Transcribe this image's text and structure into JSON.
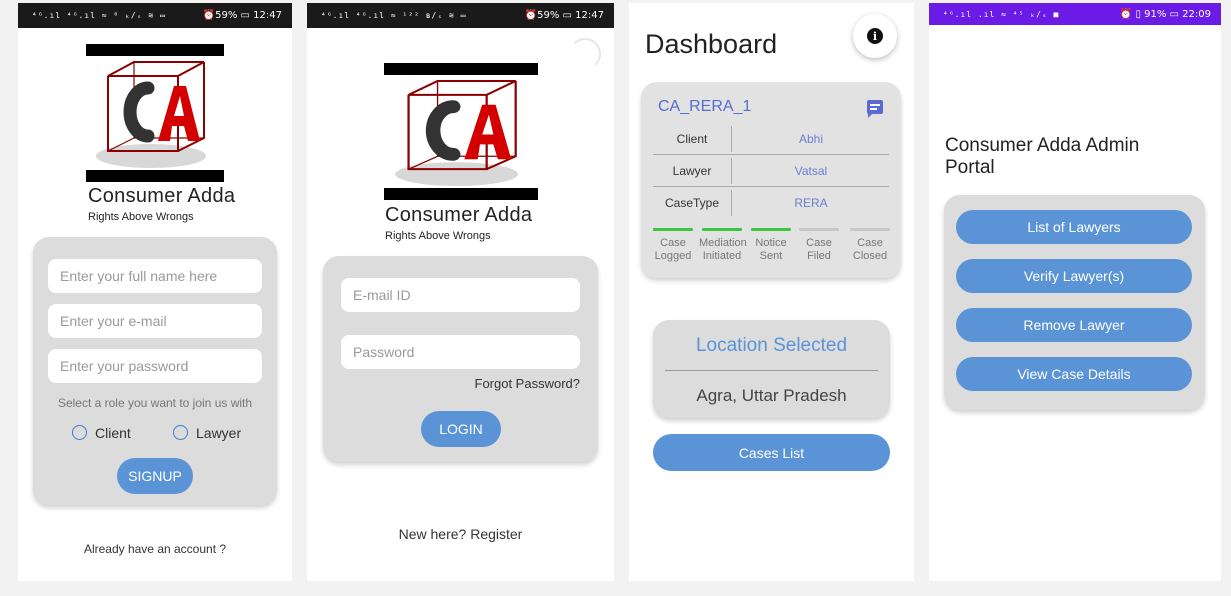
{
  "screen1": {
    "status": {
      "signal": "⁴ᴳ.ıl ⁴ᴳ.ıl ≈ ⁰ ₖ/ₛ ≋ ▭",
      "battery": "⏰59% ▭ 12:47"
    },
    "brand": {
      "title": "Consumer Adda",
      "subtitle": "Rights Above Wrongs"
    },
    "fields": {
      "name_placeholder": "Enter your full name here",
      "email_placeholder": "Enter your e-mail",
      "password_placeholder": "Enter your password"
    },
    "role_prompt": "Select a role you want to join us with",
    "roles": [
      "Client",
      "Lawyer"
    ],
    "signup_label": "SIGNUP",
    "login_link": "Already have an account ?"
  },
  "screen2": {
    "status": {
      "signal": "⁴ᴳ.ıl ⁴ᴳ.ıl ≈ ¹²² ʙ/ₛ ≋ ▭",
      "battery": "⏰59% ▭ 12:47"
    },
    "brand": {
      "title": "Consumer Adda",
      "subtitle": "Rights Above Wrongs"
    },
    "fields": {
      "email_placeholder": "E-mail ID",
      "password_placeholder": "Password"
    },
    "forgot_label": "Forgot Password?",
    "login_label": "LOGIN",
    "register_link": "New here? Register"
  },
  "screen3": {
    "title": "Dashboard",
    "info_icon": "info-icon",
    "case": {
      "id": "CA_RERA_1",
      "rows": [
        {
          "key": "Client",
          "value": "Abhi"
        },
        {
          "key": "Lawyer",
          "value": "Vatsal"
        },
        {
          "key": "CaseType",
          "value": "RERA"
        }
      ],
      "stages": [
        {
          "line1": "Case",
          "line2": "Logged",
          "color": "#3ec43e"
        },
        {
          "line1": "Mediation",
          "line2": "Initiated",
          "color": "#3ec43e"
        },
        {
          "line1": "Notice",
          "line2": "Sent",
          "color": "#3ec43e"
        },
        {
          "line1": "Case",
          "line2": "Filed",
          "color": "#c8c8c8"
        },
        {
          "line1": "Case",
          "line2": "Closed",
          "color": "#c8c8c8"
        }
      ]
    },
    "location": {
      "heading": "Location Selected",
      "value": "Agra, Uttar Pradesh"
    },
    "cases_list_label": "Cases List"
  },
  "screen4": {
    "status": {
      "signal": "⁴ᴳ.ıl .ıl ≈ ⁴⁵ ₖ/ₛ ■",
      "battery": "⏰ ▯ 91% ▭ 22:09"
    },
    "title": "Consumer Adda Admin Portal",
    "buttons": [
      "List of Lawyers",
      "Verify Lawyer(s)",
      "Remove Lawyer",
      "View Case Details"
    ]
  },
  "colors": {
    "accent": "#5b94d6",
    "statusbar_dark": "#1a1a1a",
    "statusbar_purple": "#6a1be6",
    "case_title": "#5a6bd1"
  }
}
